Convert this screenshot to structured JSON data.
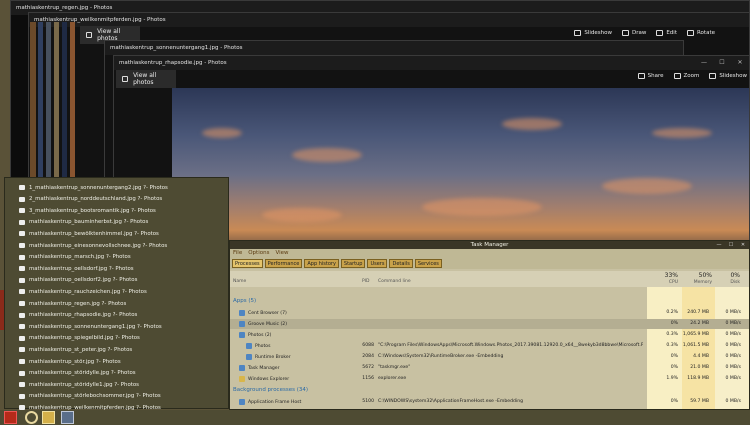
{
  "windows": [
    {
      "title": "mathiaskentrup_regen.jpg - Photos"
    },
    {
      "title": "mathiaskentrup_weilkenmitpferden.jpg - Photos"
    },
    {
      "title": "mathiaskentrup_sonnenuntergang1.jpg - Photos"
    },
    {
      "title": "mathiaskentrup_rhapsodie.jpg - Photos"
    }
  ],
  "photos_back": {
    "view_all": "View all photos",
    "toolbar": [
      "Slideshow",
      "Draw",
      "Edit",
      "Rotate"
    ]
  },
  "photos_front": {
    "view_all": "View all photos",
    "toolbar": [
      "Share",
      "Zoom",
      "Slideshow"
    ]
  },
  "jumplist": [
    "1_mathiaskentrup_sonnenuntergang2.jpg ?- Photos",
    "2_mathiaskentrup_norddeutschland.jpg ?- Photos",
    "3_mathiaskentrup_bootsromantik.jpg ?- Photos",
    "mathiaskentrup_bauminherbst.jpg ?- Photos",
    "mathiaskentrup_bewölktenhimmel.jpg ?- Photos",
    "mathiaskentrup_einesonnevollschnee.jpg ?- Photos",
    "mathiaskentrup_marsch.jpg ?- Photos",
    "mathiaskentrup_oellsdorf.jpg ?- Photos",
    "mathiaskentrup_oellsdorf2.jpg ?- Photos",
    "mathiaskentrup_rauchzeichen.jpg ?- Photos",
    "mathiaskentrup_regen.jpg ?- Photos",
    "mathiaskentrup_rhapsodie.jpg ?- Photos",
    "mathiaskentrup_sonnenuntergang1.jpg ?- Photos",
    "mathiaskentrup_spiegelbild.jpg ?- Photos",
    "mathiaskentrup_st_peter.jpg ?- Photos",
    "mathiaskentrup_stör.jpg ?- Photos",
    "mathiaskentrup_störidylle.jpg ?- Photos",
    "mathiaskentrup_störidylle1.jpg ?- Photos",
    "mathiaskentrup_störlebochsommer.jpg ?- Photos",
    "mathiaskentrup_weilkenmitpferden.jpg ?- Photos"
  ],
  "task_manager": {
    "title": "Task Manager",
    "menu": [
      "File",
      "Options",
      "View"
    ],
    "tabs": [
      "Processes",
      "Performance",
      "App history",
      "Startup",
      "Users",
      "Details",
      "Services"
    ],
    "headers": {
      "name": "Name",
      "pid": "PID",
      "cmd": "Command line",
      "cpu_pct": "33%",
      "cpu": "CPU",
      "mem_pct": "50%",
      "mem": "Memory",
      "disk_pct": "0%",
      "disk": "Disk"
    },
    "group_apps": "Apps (5)",
    "group_bg": "Background processes (34)",
    "rows": [
      {
        "name": "Cent Browser (7)",
        "pid": "",
        "cmd": "",
        "cpu": "0.2%",
        "mem": "240.7 MB",
        "disk": "0 MB/s"
      },
      {
        "name": "Groove Music (2)",
        "pid": "",
        "cmd": "",
        "cpu": "0%",
        "mem": "24.2 MB",
        "disk": "0 MB/s"
      },
      {
        "name": "Photos (2)",
        "pid": "",
        "cmd": "",
        "cpu": "0.3%",
        "mem": "1,065.9 MB",
        "disk": "0 MB/s"
      },
      {
        "name": "Photos",
        "pid": "6088",
        "cmd": "\"C:\\Program Files\\WindowsApps\\Microsoft.Windows.Photos_2017.39081.12920.0_x64__8wekyb3d8bbwe\\Microsoft.Pho...",
        "cpu": "0.3%",
        "mem": "1,061.5 MB",
        "disk": "0 MB/s"
      },
      {
        "name": "Runtime Broker",
        "pid": "2084",
        "cmd": "C:\\Windows\\System32\\RuntimeBroker.exe -Embedding",
        "cpu": "0%",
        "mem": "4.4 MB",
        "disk": "0 MB/s"
      },
      {
        "name": "Task Manager",
        "pid": "5672",
        "cmd": "\"taskmgr.exe\"",
        "cpu": "0%",
        "mem": "21.0 MB",
        "disk": "0 MB/s"
      },
      {
        "name": "Windows Explorer",
        "pid": "1156",
        "cmd": "explorer.exe",
        "cpu": "1.9%",
        "mem": "118.9 MB",
        "disk": "0 MB/s"
      },
      {
        "name": "Application Frame Host",
        "pid": "5100",
        "cmd": "C:\\WINDOWS\\system32\\ApplicationFrameHost.exe -Embedding",
        "cpu": "0%",
        "mem": "59.7 MB",
        "disk": "0 MB/s"
      }
    ]
  },
  "colors": {
    "desktop": "#5a5238",
    "taskbar": "#4e4b33",
    "tm_bg": "#c8c1a2",
    "tm_tab": "#c9a24a"
  }
}
